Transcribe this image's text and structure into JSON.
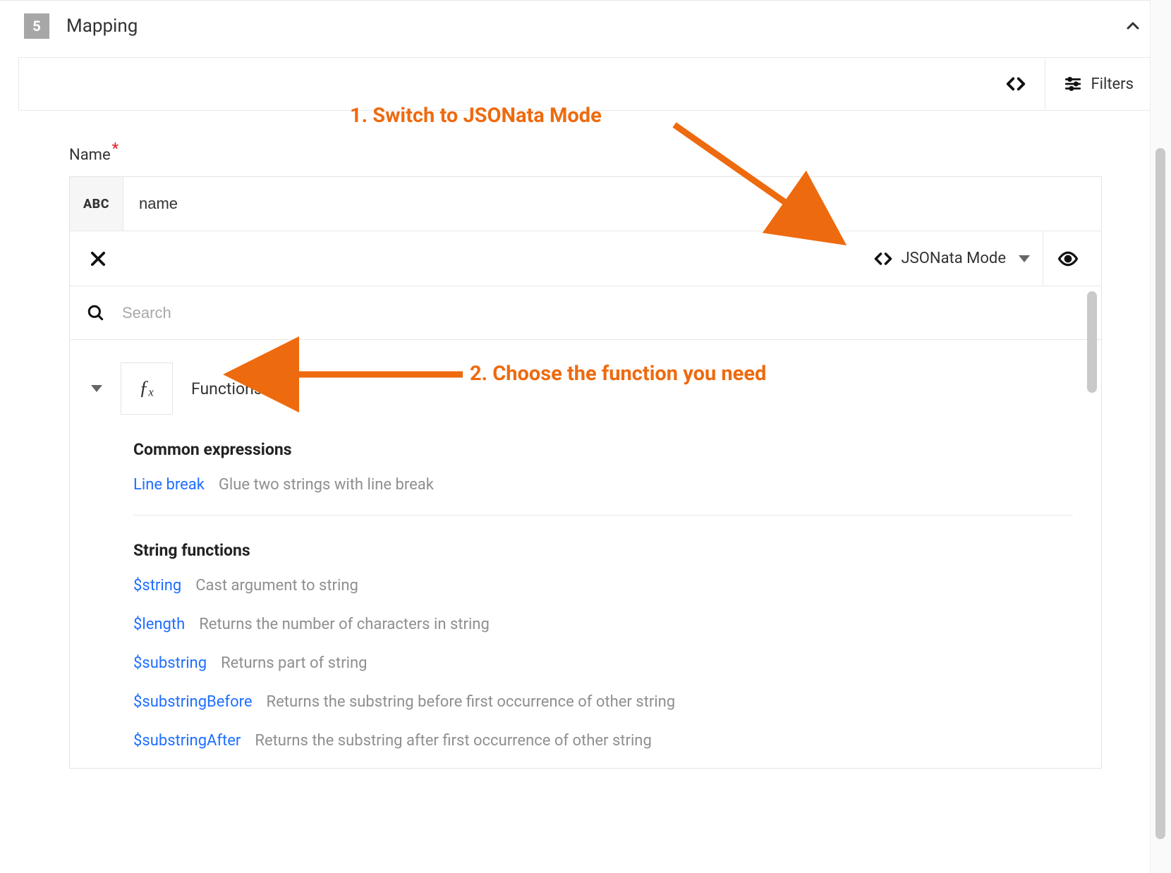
{
  "header": {
    "step": "5",
    "title": "Mapping"
  },
  "toolbar": {
    "filters_label": "Filters"
  },
  "field": {
    "label": "Name",
    "type_badge": "ABC",
    "value": "name"
  },
  "mode": {
    "label": "JSONata Mode"
  },
  "search": {
    "placeholder": "Search"
  },
  "functions": {
    "fx_glyph": "ƒₓ",
    "heading": "Functions",
    "groups": [
      {
        "title": "Common expressions",
        "items": [
          {
            "name": "Line break",
            "desc": "Glue two strings with line break"
          }
        ]
      },
      {
        "title": "String functions",
        "items": [
          {
            "name": "$string",
            "desc": "Cast argument to string"
          },
          {
            "name": "$length",
            "desc": "Returns the number of characters in string"
          },
          {
            "name": "$substring",
            "desc": "Returns part of string"
          },
          {
            "name": "$substringBefore",
            "desc": "Returns the substring before first occurrence of other string"
          },
          {
            "name": "$substringAfter",
            "desc": "Returns the substring after first occurrence of other string"
          }
        ]
      }
    ]
  },
  "annotations": {
    "step1": "1. Switch to JSONata Mode",
    "step2": "2. Choose the function you need"
  },
  "colors": {
    "accent": "#ee6a0e",
    "link": "#1f6fff"
  }
}
